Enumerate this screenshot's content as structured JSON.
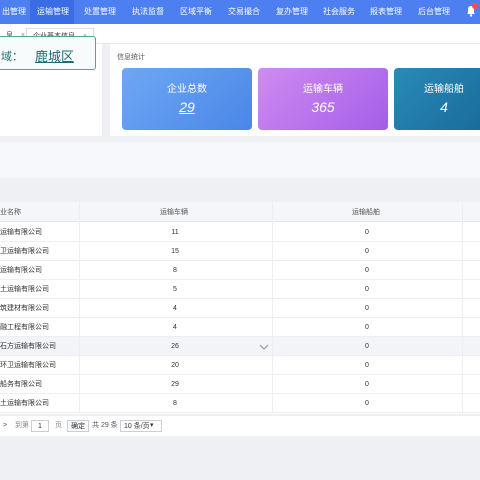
{
  "nav": {
    "items": [
      {
        "label": "出管理",
        "active": false
      },
      {
        "label": "运输管理",
        "active": true
      },
      {
        "label": "处置管理",
        "active": false
      },
      {
        "label": "执法监督",
        "active": false
      },
      {
        "label": "区域平衡",
        "active": false
      },
      {
        "label": "交易撮合",
        "active": false
      },
      {
        "label": "复办管理",
        "active": false
      },
      {
        "label": "社会服务",
        "active": false
      },
      {
        "label": "报表管理",
        "active": false
      },
      {
        "label": "后台管理",
        "active": false
      }
    ],
    "bell_icon": "bell-icon"
  },
  "tabs": [
    {
      "label": "息",
      "active": false
    },
    {
      "label": "企业基本信息",
      "active": true,
      "close": "×"
    }
  ],
  "tabs_extra_close": "×",
  "city": {
    "label": "域：",
    "value": "鹿城区"
  },
  "info": {
    "title": "信息统计",
    "stats": [
      {
        "label": "企业总数",
        "value": "29"
      },
      {
        "label": "运输车辆",
        "value": "365"
      },
      {
        "label": "运输船舶",
        "value": "4"
      }
    ]
  },
  "table": {
    "headers": [
      "业名称",
      "运输车辆",
      "运输船舶"
    ],
    "rows": [
      {
        "name": "运输有限公司",
        "vehicles": "11",
        "ships": "0"
      },
      {
        "name": "卫运输有限公司",
        "vehicles": "15",
        "ships": "0"
      },
      {
        "name": "运输有限公司",
        "vehicles": "8",
        "ships": "0"
      },
      {
        "name": "土运输有限公司",
        "vehicles": "5",
        "ships": "0"
      },
      {
        "name": "筑建材有限公司",
        "vehicles": "4",
        "ships": "0"
      },
      {
        "name": "融工程有限公司",
        "vehicles": "4",
        "ships": "0"
      },
      {
        "name": "石方运输有限公司",
        "vehicles": "26",
        "ships": "0"
      },
      {
        "name": "环卫运输有限公司",
        "vehicles": "20",
        "ships": "0"
      },
      {
        "name": "船务有限公司",
        "vehicles": "29",
        "ships": "0"
      },
      {
        "name": "土运输有限公司",
        "vehicles": "8",
        "ships": "0"
      }
    ]
  },
  "pager": {
    "next": ">",
    "goto_label": "到第",
    "page_value": "1",
    "page_label": "页",
    "confirm": "确定",
    "total": "共 29 条",
    "page_size": "10 条/页",
    "size_arrow": "▾"
  }
}
